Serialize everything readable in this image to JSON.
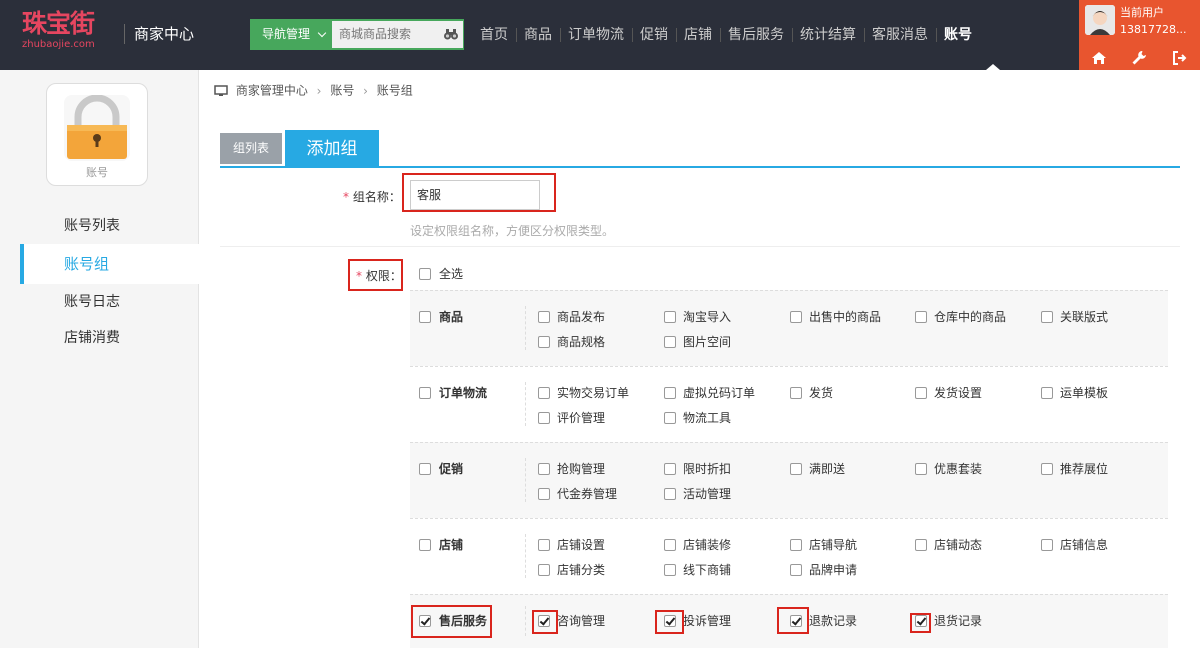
{
  "logo": {
    "cn": "珠宝街",
    "en": "zhubaojie.com"
  },
  "header": {
    "center_title": "商家中心",
    "nav_button": "导航管理",
    "search_placeholder": "商城商品搜索",
    "nav": [
      "首页",
      "商品",
      "订单物流",
      "促销",
      "店铺",
      "售后服务",
      "统计结算",
      "客服消息",
      "账号"
    ],
    "active_nav": "账号"
  },
  "user": {
    "label": "当前用户",
    "phone": "13817728..."
  },
  "sidebar": {
    "icon_label": "账号",
    "items": [
      "账号列表",
      "账号组",
      "账号日志",
      "店铺消费"
    ],
    "active": "账号组"
  },
  "breadcrumb": [
    "商家管理中心",
    "账号",
    "账号组"
  ],
  "tabs": {
    "list": "组列表",
    "add": "添加组"
  },
  "form": {
    "name_label": "组名称：",
    "name_value": "客服",
    "name_hint": "设定权限组名称，方便区分权限类型。",
    "perm_label": "权限：",
    "select_all": "全选"
  },
  "permissions": [
    {
      "group": "商品",
      "checked": false,
      "items": [
        {
          "label": "商品发布",
          "checked": false
        },
        {
          "label": "淘宝导入",
          "checked": false
        },
        {
          "label": "出售中的商品",
          "checked": false
        },
        {
          "label": "仓库中的商品",
          "checked": false
        },
        {
          "label": "关联版式",
          "checked": false
        },
        {
          "label": "商品规格",
          "checked": false
        },
        {
          "label": "图片空间",
          "checked": false
        }
      ]
    },
    {
      "group": "订单物流",
      "checked": false,
      "items": [
        {
          "label": "实物交易订单",
          "checked": false
        },
        {
          "label": "虚拟兑码订单",
          "checked": false
        },
        {
          "label": "发货",
          "checked": false
        },
        {
          "label": "发货设置",
          "checked": false
        },
        {
          "label": "运单模板",
          "checked": false
        },
        {
          "label": "评价管理",
          "checked": false
        },
        {
          "label": "物流工具",
          "checked": false
        }
      ]
    },
    {
      "group": "促销",
      "checked": false,
      "items": [
        {
          "label": "抢购管理",
          "checked": false
        },
        {
          "label": "限时折扣",
          "checked": false
        },
        {
          "label": "满即送",
          "checked": false
        },
        {
          "label": "优惠套装",
          "checked": false
        },
        {
          "label": "推荐展位",
          "checked": false
        },
        {
          "label": "代金券管理",
          "checked": false
        },
        {
          "label": "活动管理",
          "checked": false
        }
      ]
    },
    {
      "group": "店铺",
      "checked": false,
      "items": [
        {
          "label": "店铺设置",
          "checked": false
        },
        {
          "label": "店铺装修",
          "checked": false
        },
        {
          "label": "店铺导航",
          "checked": false
        },
        {
          "label": "店铺动态",
          "checked": false
        },
        {
          "label": "店铺信息",
          "checked": false
        },
        {
          "label": "店铺分类",
          "checked": false
        },
        {
          "label": "线下商铺",
          "checked": false
        },
        {
          "label": "品牌申请",
          "checked": false
        }
      ]
    },
    {
      "group": "售后服务",
      "checked": true,
      "items": [
        {
          "label": "咨询管理",
          "checked": true
        },
        {
          "label": "投诉管理",
          "checked": true
        },
        {
          "label": "退款记录",
          "checked": true
        },
        {
          "label": "退货记录",
          "checked": true
        }
      ]
    }
  ],
  "colors": {
    "accent": "#27a9e3",
    "header_bg": "#2b2f3a",
    "user_bg": "#e8552f",
    "nav_green": "#47a75c",
    "highlight_red": "#d9251d",
    "logo_pink": "#e64660"
  }
}
